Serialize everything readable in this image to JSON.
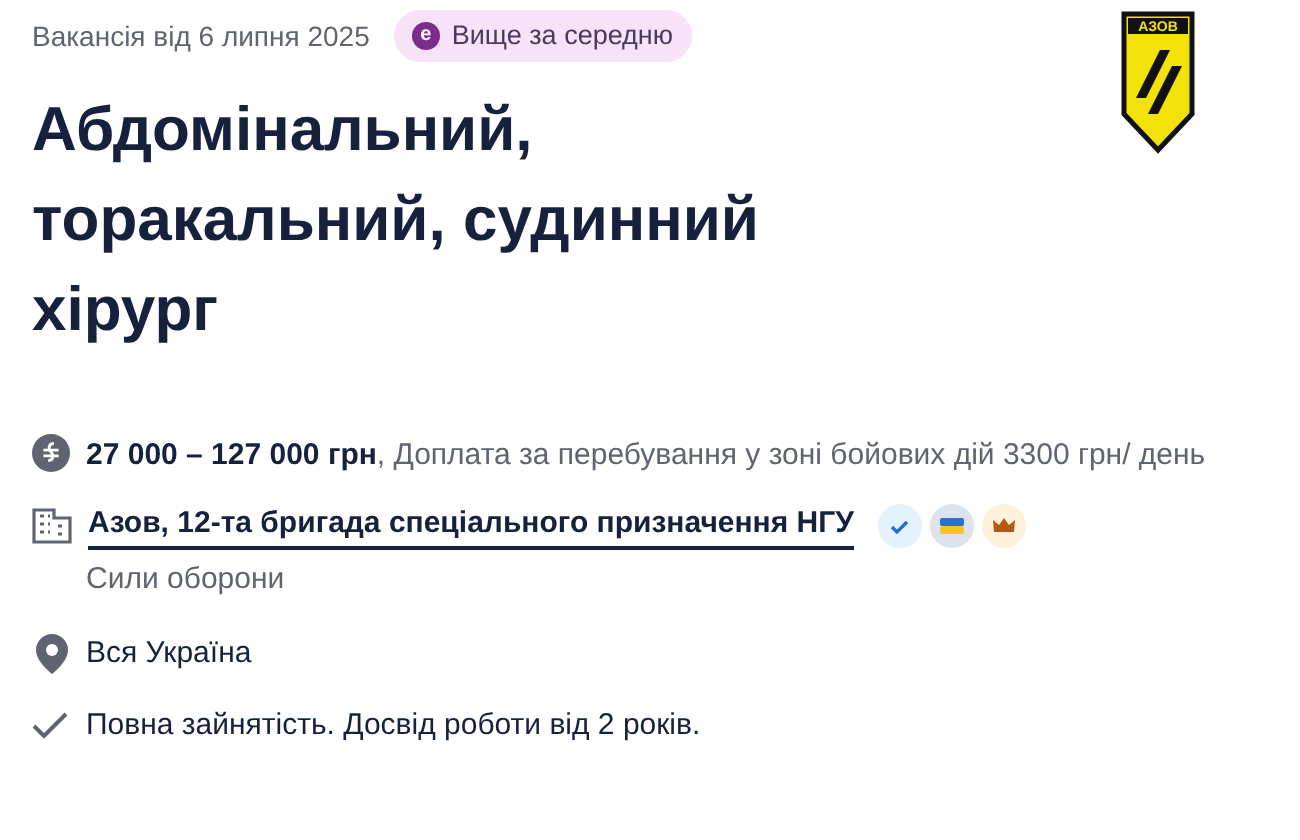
{
  "posted": "Вакансія від 6 липня 2025",
  "salary_badge": {
    "icon": "e",
    "label": "Вище за середню"
  },
  "logo": {
    "text": "АЗОВ"
  },
  "title": "Абдомінальний, торакальний, судинний хірург",
  "salary": "**27 000 – 127 000 грн**, Доплата за перебування у зоні бойових дій 3300 грн/ день",
  "company": {
    "name": "Азов, 12-та бригада спеціального призначення НГУ",
    "category": "Сили оборони",
    "badges": [
      {
        "kind": "verified"
      },
      {
        "kind": "flag"
      },
      {
        "kind": "crown"
      }
    ]
  },
  "location": "Вся Україна",
  "conditions": "Повна зайнятість. Досвід роботи від 2 років."
}
